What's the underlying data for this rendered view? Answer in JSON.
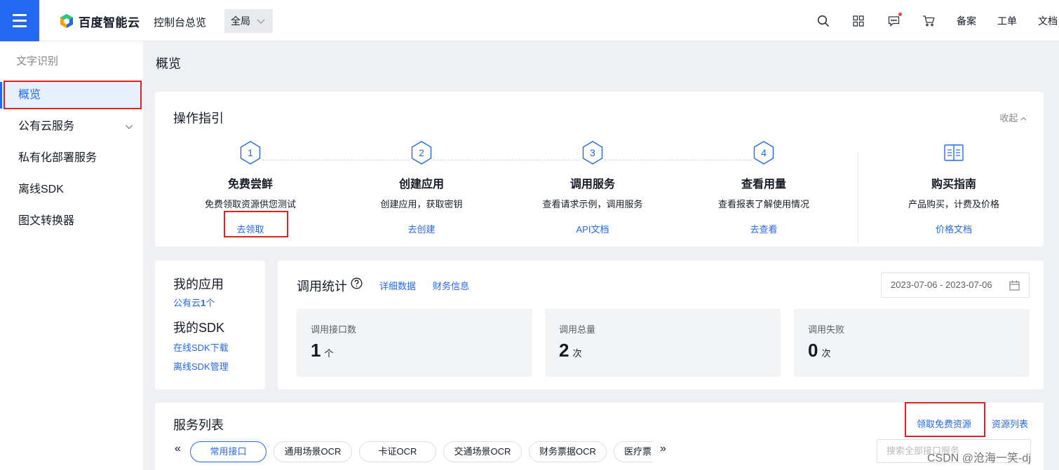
{
  "header": {
    "brand": "百度智能云",
    "console_link": "控制台总览",
    "region": "全局",
    "icons": [
      "search-icon",
      "grid-icon",
      "message-icon",
      "cart-icon"
    ],
    "links": [
      "备案",
      "工单",
      "文档"
    ]
  },
  "sidebar": {
    "title": "文字识别",
    "items": [
      {
        "label": "概览"
      },
      {
        "label": "公有云服务"
      },
      {
        "label": "私有化部署服务"
      },
      {
        "label": "离线SDK"
      },
      {
        "label": "图文转换器"
      }
    ]
  },
  "page": {
    "title": "概览"
  },
  "guide": {
    "title": "操作指引",
    "collapse": "收起",
    "steps": [
      {
        "num": "1",
        "name": "免费尝鲜",
        "desc": "免费领取资源供您测试",
        "link": "去领取"
      },
      {
        "num": "2",
        "name": "创建应用",
        "desc": "创建应用，获取密钥",
        "link": "去创建"
      },
      {
        "num": "3",
        "name": "调用服务",
        "desc": "查看请求示例，调用服务",
        "link": "API文档"
      },
      {
        "num": "4",
        "name": "查看用量",
        "desc": "查看报表了解使用情况",
        "link": "去查看"
      }
    ],
    "buy": {
      "name": "购买指南",
      "desc": "产品购买，计费及价格",
      "link": "价格文档"
    }
  },
  "apps": {
    "my_apps": "我的应用",
    "public_prefix": "公有云",
    "public_count": "1",
    "public_suffix": "个",
    "my_sdk": "我的SDK",
    "sdk_download": "在线SDK下载",
    "sdk_manage": "离线SDK管理"
  },
  "stats": {
    "title": "调用统计",
    "detail_link": "详细数据",
    "finance_link": "财务信息",
    "date_range": "2023-07-06 - 2023-07-06",
    "metrics": [
      {
        "label": "调用接口数",
        "value": "1",
        "unit": "个"
      },
      {
        "label": "调用总量",
        "value": "2",
        "unit": "次"
      },
      {
        "label": "调用失败",
        "value": "0",
        "unit": "次"
      }
    ]
  },
  "services": {
    "title": "服务列表",
    "free_link": "领取免费资源",
    "resource_link": "资源列表",
    "prev": "«",
    "next": "»",
    "tabs": [
      "常用接口",
      "通用场景OCR",
      "卡证OCR",
      "交通场景OCR",
      "财务票据OCR",
      "医疗票"
    ],
    "search_placeholder": "搜索全部接口服务"
  },
  "watermark": "CSDN @沧海一笑-dj"
}
